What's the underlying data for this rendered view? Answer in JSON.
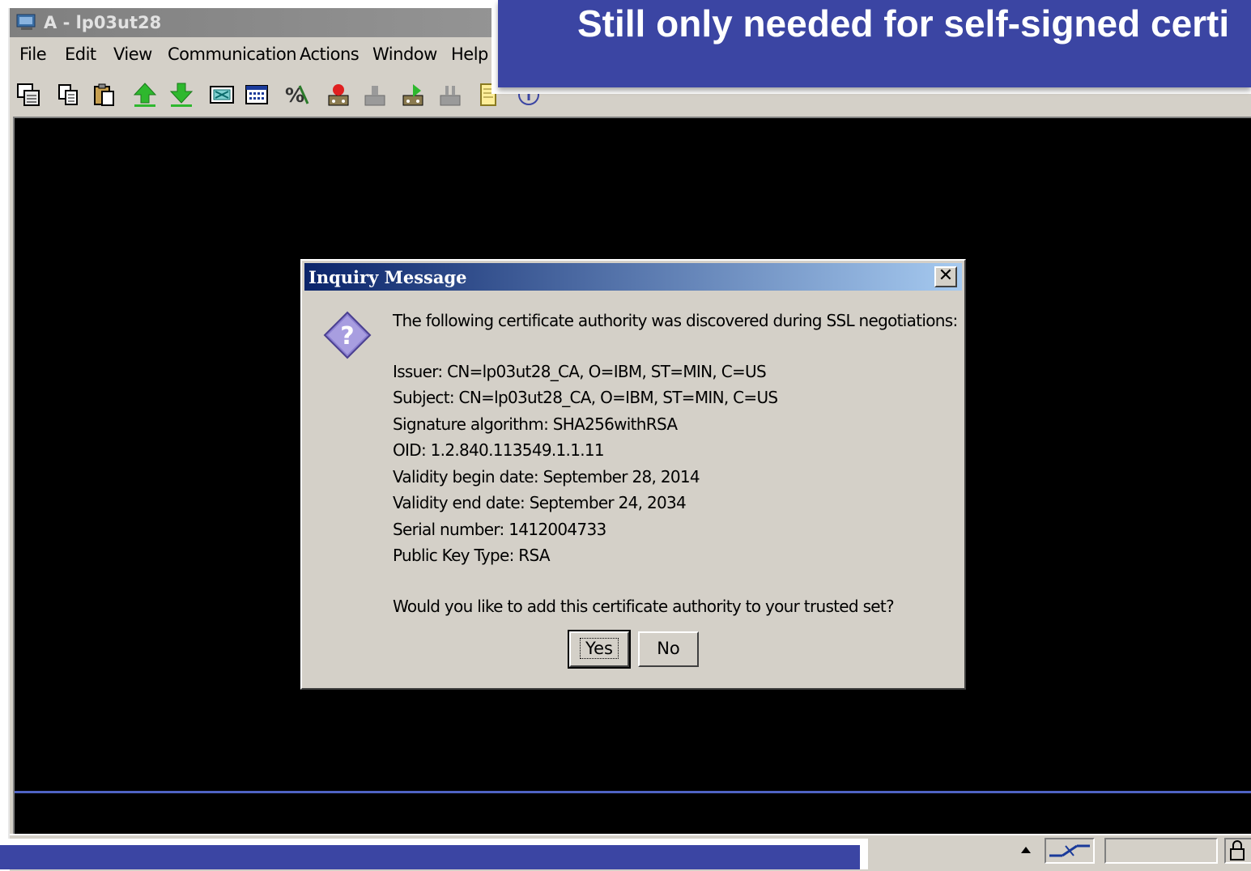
{
  "window": {
    "title": "A - lp03ut28"
  },
  "menu": [
    "File",
    "Edit",
    "View",
    "Communication",
    "Actions",
    "Window",
    "Help"
  ],
  "toolbar_icons": [
    "copy-screen-icon",
    "copy-icon",
    "paste-icon",
    "send-file-icon",
    "receive-file-icon",
    "display-keypad-icon",
    "display-grid-icon",
    "macro-icon",
    "record-macro-icon",
    "stop-macro-icon",
    "play-macro-icon",
    "print-icon",
    "notes-icon",
    "info-icon"
  ],
  "banner": {
    "text": "Still only needed for self-signed certi"
  },
  "dialog": {
    "title": "Inquiry Message",
    "close_label": "✕",
    "intro": "The following certificate authority was discovered during SSL negotiations:",
    "details": [
      "Issuer: CN=lp03ut28_CA, O=IBM, ST=MIN, C=US",
      "Subject: CN=lp03ut28_CA, O=IBM, ST=MIN, C=US",
      "Signature algorithm: SHA256withRSA",
      "OID: 1.2.840.113549.1.1.11",
      "Validity begin date: September 28, 2014",
      "Validity end date: September 24, 2034",
      "Serial number: 1412004733",
      "Public Key Type: RSA"
    ],
    "question": "Would you like to add this certificate authority to your trusted set?",
    "yes_label": "Yes",
    "no_label": "No"
  },
  "colors": {
    "banner": "#3b45a3",
    "terminal": "#000000",
    "oia_line": "#4f63c4",
    "dialog_title_start": "#0a246a",
    "dialog_title_end": "#a6caf0"
  }
}
